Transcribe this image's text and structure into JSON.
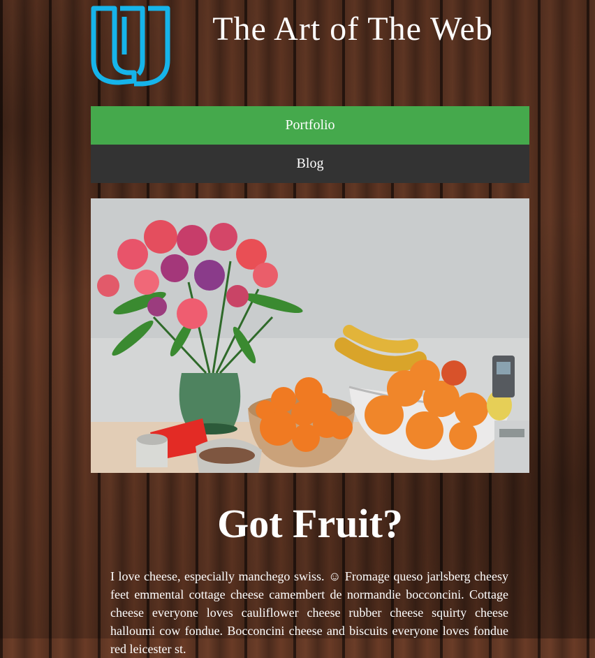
{
  "site": {
    "title": "The Art of The Web",
    "logo_icon": "udacity-u-logo-icon",
    "logo_color": "#16b4ea"
  },
  "nav": {
    "items": [
      {
        "label": "Portfolio",
        "active": true
      },
      {
        "label": "Blog",
        "active": false
      }
    ],
    "active_color": "#45a94c",
    "inactive_color": "#333333"
  },
  "hero": {
    "image_icon": "fruit-and-flowers-photo"
  },
  "article": {
    "title": "Got Fruit?",
    "body": "I love cheese, especially manchego swiss. ☺ Fromage queso jarlsberg cheesy feet emmental cottage cheese camembert de normandie bocconcini. Cottage cheese everyone loves cauliflower cheese rubber cheese squirty cheese halloumi cow fondue. Bocconcini cheese and biscuits everyone loves fondue red leicester st."
  }
}
